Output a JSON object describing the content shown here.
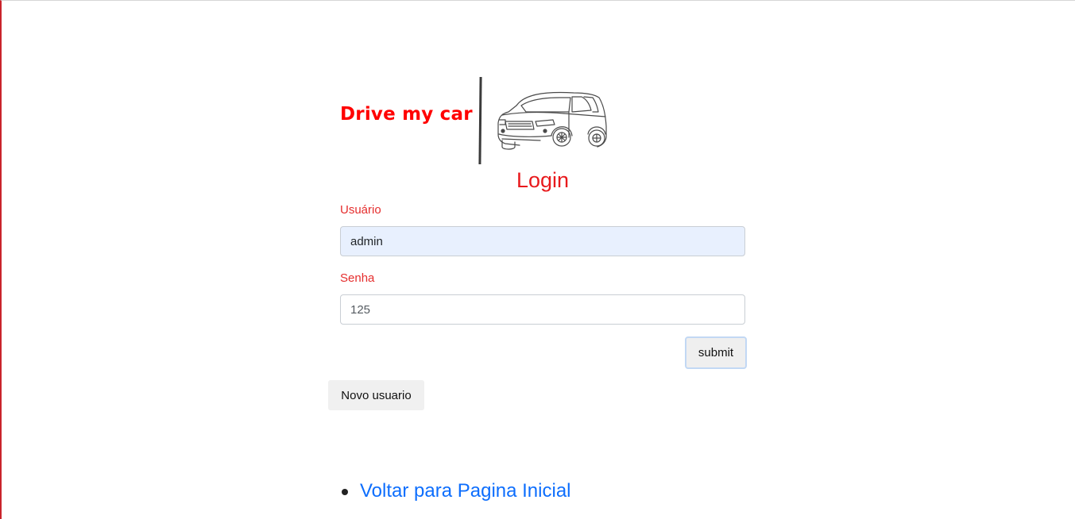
{
  "brand": {
    "name": "Drive my car",
    "logo_icon": "car-icon"
  },
  "login": {
    "title": "Login",
    "username_label": "Usuário",
    "username_value": "admin",
    "password_label": "Senha",
    "password_value": "125",
    "submit_label": "submit"
  },
  "actions": {
    "new_user_label": "Novo usuario"
  },
  "links": {
    "home_label": "Voltar para Pagina Inicial"
  },
  "colors": {
    "brand_red": "#ff0000",
    "label_red": "#e52d2d",
    "link_blue": "#0d6efd",
    "autofill_bg": "#e8f0fe"
  }
}
